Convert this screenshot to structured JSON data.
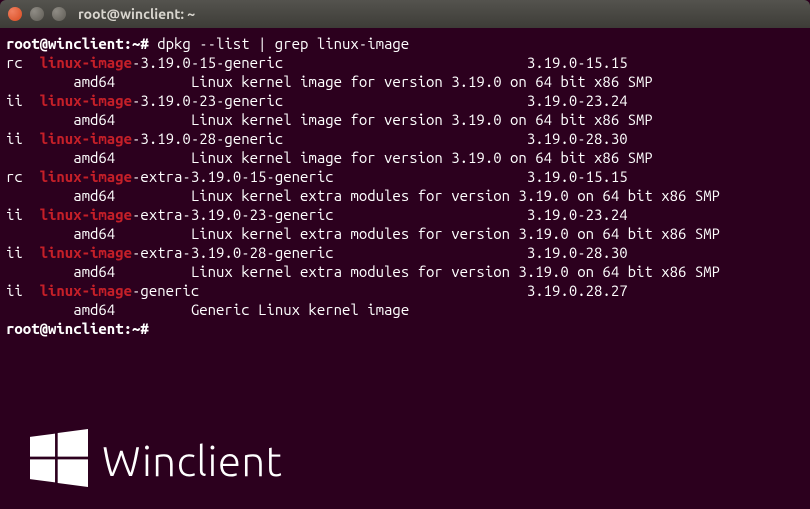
{
  "window": {
    "title": "root@winclient: ~"
  },
  "prompt": "root@winclient:~#",
  "command": "dpkg --list | grep linux-image",
  "highlight": "linux-image",
  "packages": [
    {
      "status": "rc",
      "suffix": "-3.19.0-15-generic",
      "version": "3.19.0-15.15",
      "arch": "amd64",
      "desc": "Linux kernel image for version 3.19.0 on 64 bit x86 SMP"
    },
    {
      "status": "ii",
      "suffix": "-3.19.0-23-generic",
      "version": "3.19.0-23.24",
      "arch": "amd64",
      "desc": "Linux kernel image for version 3.19.0 on 64 bit x86 SMP"
    },
    {
      "status": "ii",
      "suffix": "-3.19.0-28-generic",
      "version": "3.19.0-28.30",
      "arch": "amd64",
      "desc": "Linux kernel image for version 3.19.0 on 64 bit x86 SMP"
    },
    {
      "status": "rc",
      "suffix": "-extra-3.19.0-15-generic",
      "version": "3.19.0-15.15",
      "arch": "amd64",
      "desc": "Linux kernel extra modules for version 3.19.0 on 64 bit x86 SMP"
    },
    {
      "status": "ii",
      "suffix": "-extra-3.19.0-23-generic",
      "version": "3.19.0-23.24",
      "arch": "amd64",
      "desc": "Linux kernel extra modules for version 3.19.0 on 64 bit x86 SMP"
    },
    {
      "status": "ii",
      "suffix": "-extra-3.19.0-28-generic",
      "version": "3.19.0-28.30",
      "arch": "amd64",
      "desc": "Linux kernel extra modules for version 3.19.0 on 64 bit x86 SMP"
    },
    {
      "status": "ii",
      "suffix": "-generic",
      "version": "3.19.0.28.27",
      "arch": "amd64",
      "desc": "Generic Linux kernel image"
    }
  ],
  "columns": {
    "status": 4,
    "name": 42,
    "version_start": 62,
    "arch_indent": 8,
    "desc_start": 22
  },
  "watermark": {
    "text": "Winclient"
  }
}
